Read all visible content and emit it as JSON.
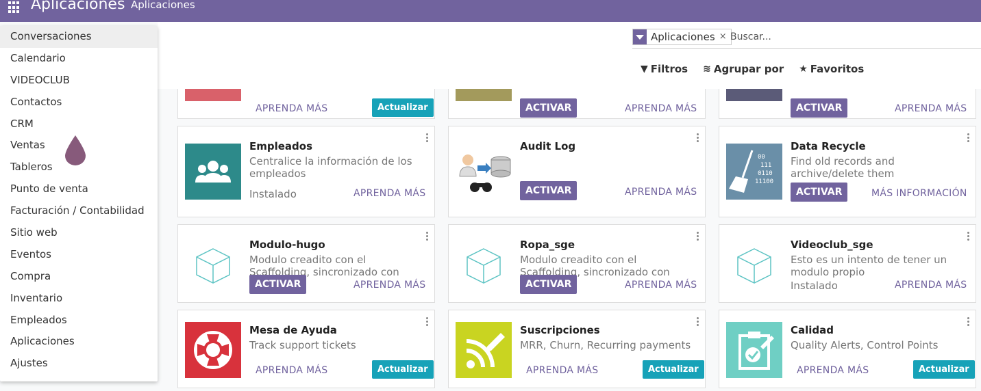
{
  "topbar": {
    "brand": "Aplicaciones",
    "menu": "Aplicaciones"
  },
  "search": {
    "facet_label": "Aplicaciones",
    "facet_remove": "×",
    "placeholder": "Buscar..."
  },
  "controls": {
    "filters": "Filtros",
    "group_by": "Agrupar por",
    "favorites": "Favoritos"
  },
  "apps_menu": {
    "items": [
      "Conversaciones",
      "Calendario",
      "VIDEOCLUB",
      "Contactos",
      "CRM",
      "Ventas",
      "Tableros",
      "Punto de venta",
      "Facturación / Contabilidad",
      "Sitio web",
      "Eventos",
      "Compra",
      "Inventario",
      "Empleados",
      "Aplicaciones",
      "Ajustes"
    ]
  },
  "colors": {
    "accent": "#71639e",
    "teal": "#17a2b8"
  },
  "cards": {
    "row0": [
      {
        "link": "APRENDA MÁS",
        "button": "Actualizar",
        "icon_color": "#d9534f"
      },
      {
        "button": "ACTIVAR",
        "link": "APRENDA MÁS",
        "icon_color": "#a69a57"
      },
      {
        "button": "ACTIVAR",
        "link": "APRENDA MÁS",
        "icon_color": "#5a5a78"
      }
    ],
    "row1": [
      {
        "title": "Empleados",
        "desc": "Centralice la información de los empleados",
        "status": "Instalado",
        "link": "APRENDA MÁS",
        "icon": "users-icon"
      },
      {
        "title": "Audit Log",
        "button": "ACTIVAR",
        "link": "APRENDA MÁS",
        "icon": "audit-log-icon"
      },
      {
        "title": "Data Recycle",
        "desc": "Find old records and archive/delete them",
        "button": "ACTIVAR",
        "link": "MÁS INFORMACIÓN",
        "icon": "broom-binary-icon"
      }
    ],
    "row2": [
      {
        "title": "Modulo-hugo",
        "desc": "Modulo creadito con el Scaffolding, sincronizado con github",
        "button": "ACTIVAR",
        "link": "APRENDA MÁS",
        "icon": "cube-icon"
      },
      {
        "title": "Ropa_sge",
        "desc": "Modulo creadito con el Scaffolding, sincronizado con github",
        "button": "ACTIVAR",
        "link": "APRENDA MÁS",
        "icon": "cube-icon"
      },
      {
        "title": "Videoclub_sge",
        "desc": "Esto es un intento de tener un modulo propio",
        "status": "Instalado",
        "link": "APRENDA MÁS",
        "icon": "cube-icon"
      }
    ],
    "row3": [
      {
        "title": "Mesa de Ayuda",
        "desc": "Track support tickets",
        "link": "APRENDA MÁS",
        "button": "Actualizar",
        "icon": "lifebuoy-icon"
      },
      {
        "title": "Suscripciones",
        "desc": "MRR, Churn, Recurring payments",
        "link": "APRENDA MÁS",
        "button": "Actualizar",
        "icon": "rss-pencil-icon"
      },
      {
        "title": "Calidad",
        "desc": "Quality Alerts, Control Points",
        "link": "APRENDA MÁS",
        "button": "Actualizar",
        "icon": "clipboard-check-icon"
      }
    ]
  }
}
